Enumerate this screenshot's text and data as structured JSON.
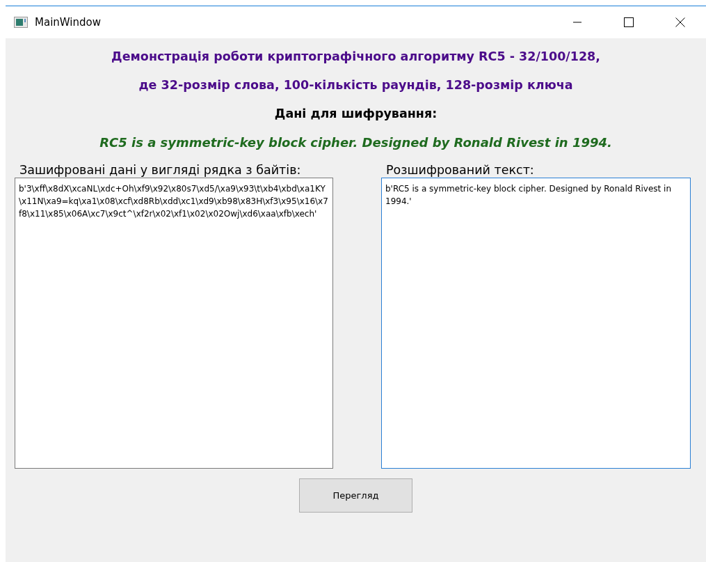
{
  "window": {
    "title": "MainWindow"
  },
  "headings": [
    {
      "text": "Демонстрація роботи криптографічного алгоритму RC5 - 32/100/128,",
      "kind": "title"
    },
    {
      "text": "де 32-розмір слова, 100-кількість раундів, 128-розмір ключа",
      "kind": "title"
    },
    {
      "text": "Дані для шифрування:",
      "kind": "label"
    },
    {
      "text": "RC5 is a symmetric-key block cipher. Designed by Ronald Rivest in 1994.",
      "kind": "plaintext"
    }
  ],
  "panels": [
    {
      "label": "Зашифровані дані у вигляді рядка з байтів:",
      "value": "b'3\\xff\\x8dX\\xcaNL\\xdc+Oh\\xf9\\x92\\x80s7\\xd5/\\xa9\\x93\\t\\xb4\\xbd\\xa1KY\\x11N\\xa9=kq\\xa1\\x08\\xcf\\xd8Rb\\xdd\\xc1\\xd9\\xb98\\x83H\\xf3\\x95\\x16\\x7f8\\x11\\x85\\x06A\\xc7\\x9ct^\\xf2r\\x02\\xf1\\x02\\x02Owj\\xd6\\xaa\\xfb\\xech'",
      "focused": false
    },
    {
      "label": "Розшифрований текст:",
      "value": "b'RC5 is a symmetric-key block cipher. Designed by Ronald Rivest in 1994.'",
      "focused": true
    }
  ],
  "button": "Перегляд"
}
